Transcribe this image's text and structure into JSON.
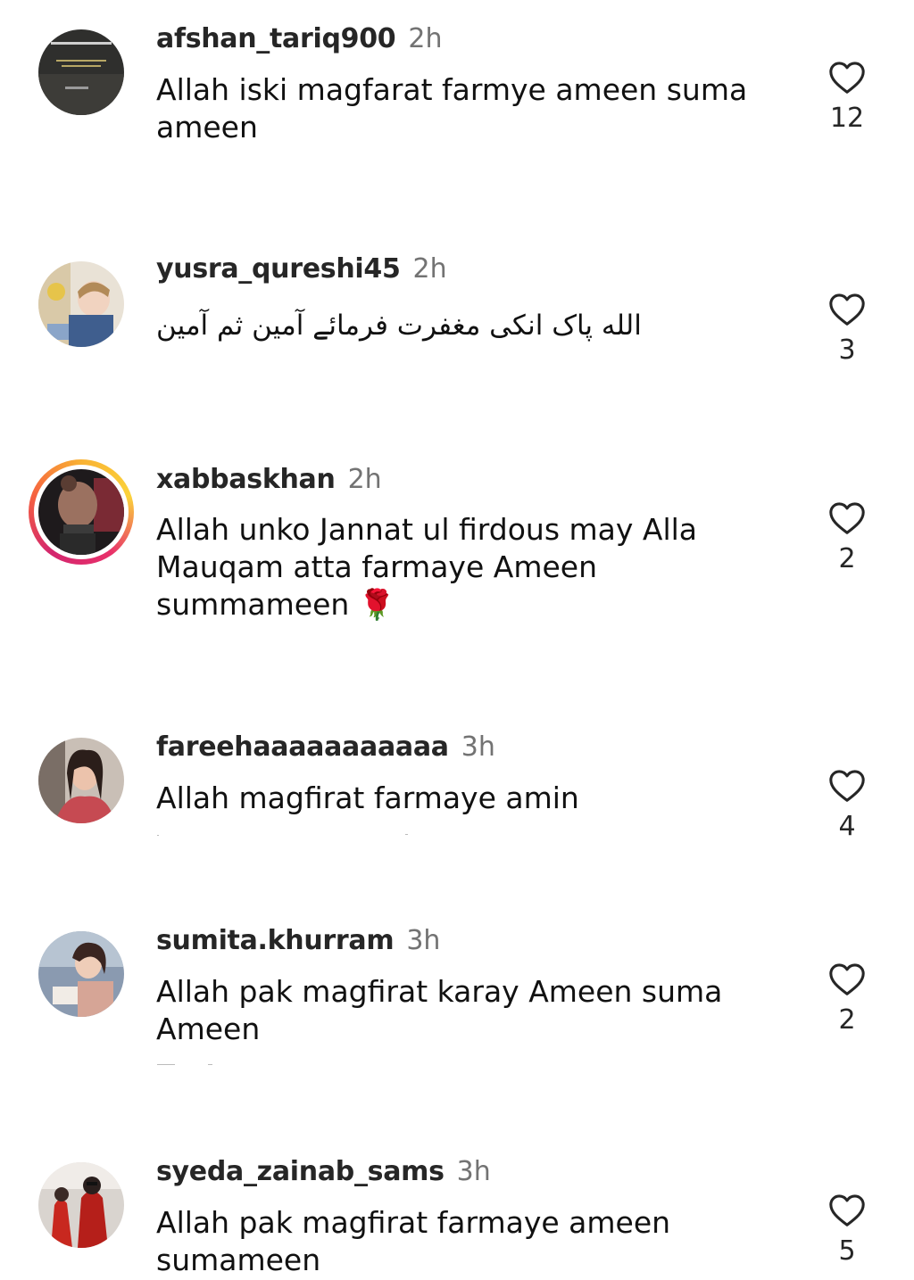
{
  "comments": [
    {
      "username": "afshan_tariq900",
      "time": "2h",
      "text": "Allah iski magfarat farmye ameen suma ameen",
      "likes": "12",
      "avatar_icon": "dark-quote-avatar"
    },
    {
      "username": "yusra_qureshi45",
      "time": "2h",
      "text": "الله پاک انکی مغفرت فرمائے آمین ثم آمین",
      "likes": "3",
      "avatar_icon": "child-photo-avatar"
    },
    {
      "username": "xabbaskhan",
      "time": "2h",
      "text": "Allah unko Jannat ul firdous may Alla Mauqam atta farmaye Ameen summameen 🌹",
      "likes": "2",
      "avatar_icon": "man-photo-avatar"
    },
    {
      "username": "fareehaaaaaaaaaaa",
      "time": "3h",
      "text": "Allah magfirat farmaye amin",
      "likes": "4",
      "avatar_icon": "girl-photo-avatar"
    },
    {
      "username": "sumita.khurram",
      "time": "3h",
      "text": "Allah pak magfirat karay Ameen suma Ameen",
      "likes": "2",
      "avatar_icon": "girl-book-avatar"
    },
    {
      "username": "syeda_zainab_sams",
      "time": "3h",
      "text": "Allah pak magfirat farmaye ameen sumameen",
      "likes": "5",
      "avatar_icon": "red-figures-avatar"
    }
  ],
  "colors": {
    "username": "#262626",
    "time": "#737373",
    "text": "#111111",
    "story_ring": "#e8306a"
  }
}
